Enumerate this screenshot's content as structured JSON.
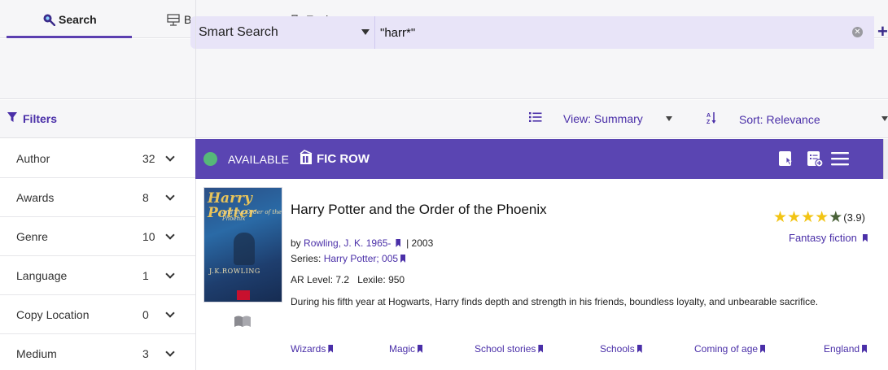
{
  "nav": {
    "tabs": [
      {
        "label": "Search",
        "icon": "magnifier-icon",
        "active": true
      },
      {
        "label": "Browse",
        "icon": "bookshelf-icon",
        "active": false
      },
      {
        "label": "Explore",
        "icon": "explore-icon",
        "active": false
      }
    ]
  },
  "search": {
    "type_label": "Smart Search",
    "query": "\"harr*\"",
    "clear_icon": "clear-icon",
    "add_label": "+"
  },
  "toolbar": {
    "filters_label": "Filters",
    "view_label": "View: Summary",
    "sort_label": "Sort: Relevance"
  },
  "facets": [
    {
      "label": "Author",
      "count": "32"
    },
    {
      "label": "Awards",
      "count": "8"
    },
    {
      "label": "Genre",
      "count": "10"
    },
    {
      "label": "Language",
      "count": "1"
    },
    {
      "label": "Copy Location",
      "count": "0"
    },
    {
      "label": "Medium",
      "count": "3"
    }
  ],
  "result": {
    "availability": "AVAILABLE",
    "call_number": "FIC ROW",
    "title": "Harry Potter and the Order of the Phoenix",
    "by_prefix": "by",
    "author": "Rowling, J. K. 1965-",
    "year": "| 2003",
    "series_prefix": "Series:",
    "series": "Harry Potter; 005",
    "ar_level": "AR Level: 7.2",
    "lexile": "Lexile: 950",
    "summary": "During his fifth year at Hogwarts, Harry finds depth and strength in his friends, boundless loyalty, and unbearable sacrifice.",
    "rating": "(3.9)",
    "rating_value": 3.9,
    "genre": "Fantasy fiction",
    "subjects": [
      "Wizards",
      "Magic",
      "School stories",
      "Schools",
      "Coming of age",
      "England"
    ],
    "cover": {
      "title": "Harry Potter",
      "subtitle": "and the Order of the Phoenix",
      "author": "J.K.ROWLING"
    }
  },
  "colors": {
    "accent": "#5a45b2",
    "link": "#4a2fa8",
    "available": "#56b879",
    "star": "#f2c414"
  }
}
